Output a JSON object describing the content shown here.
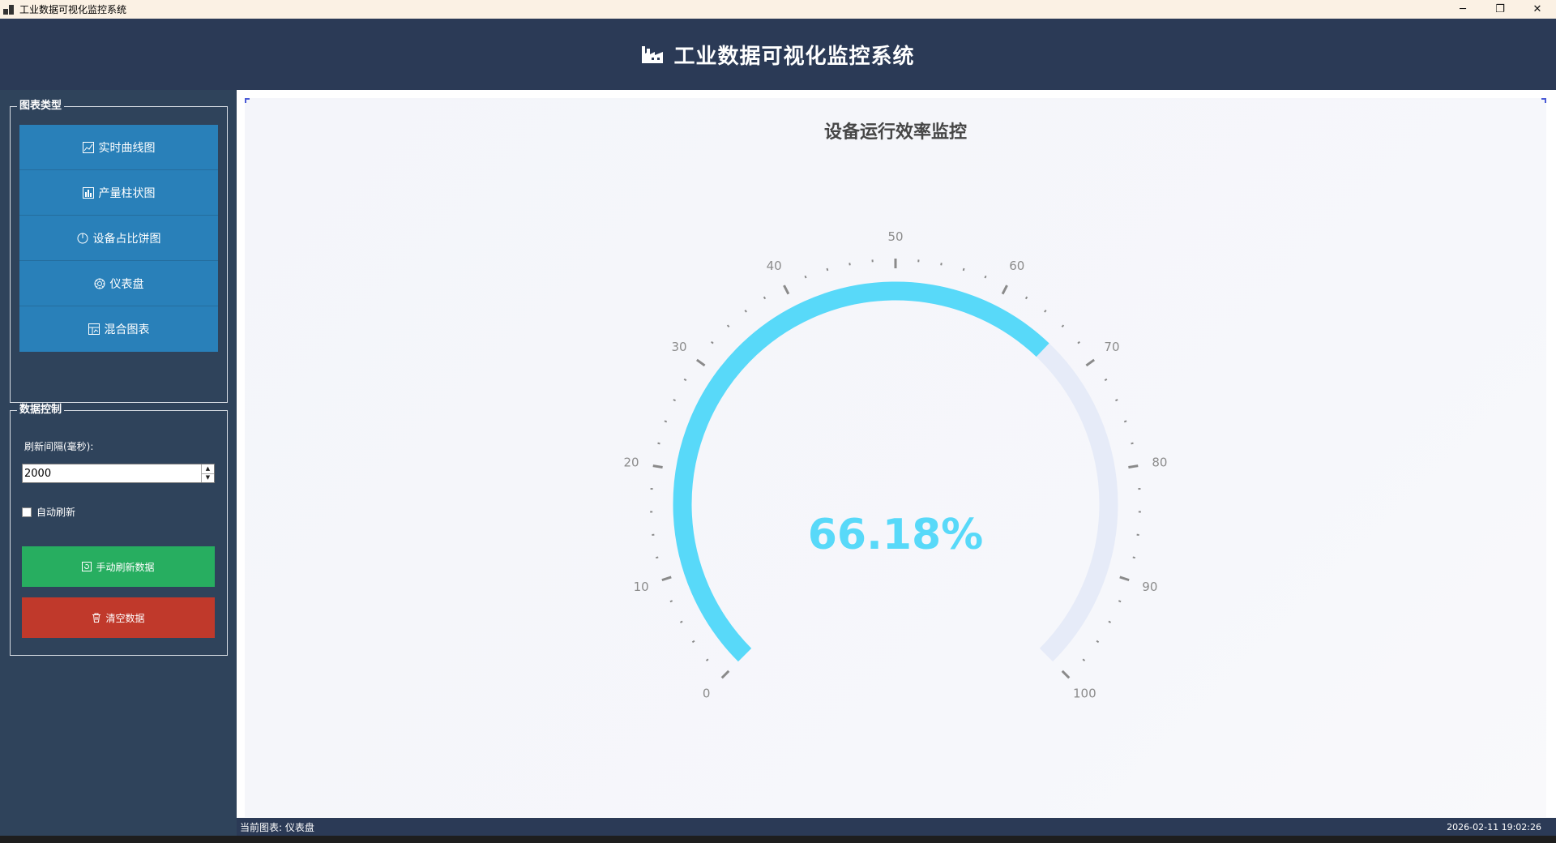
{
  "window": {
    "title": "工业数据可视化监控系统",
    "minimize": "─",
    "restore": "❐",
    "close": "✕"
  },
  "header": {
    "title": "工业数据可视化监控系统",
    "icon": "factory-icon"
  },
  "sidebar": {
    "chart_group_title": "图表类型",
    "chart_buttons": [
      {
        "label": "实时曲线图",
        "icon": "line-chart-icon"
      },
      {
        "label": "产量柱状图",
        "icon": "bar-chart-icon"
      },
      {
        "label": "设备占比饼图",
        "icon": "pie-chart-icon"
      },
      {
        "label": "仪表盘",
        "icon": "gauge-icon"
      },
      {
        "label": "混合图表",
        "icon": "mixed-chart-icon"
      }
    ],
    "data_group_title": "数据控制",
    "interval_label": "刷新间隔(毫秒):",
    "interval_value": "2000",
    "auto_refresh_label": "自动刷新",
    "auto_refresh_checked": false,
    "manual_refresh_label": "手动刷新数据",
    "clear_label": "清空数据",
    "colors": {
      "nav": "#2980b9",
      "refresh": "#27ae60",
      "clear": "#c0392b"
    }
  },
  "chart_data": {
    "type": "gauge",
    "title": "设备运行效率监控",
    "value": 66.18,
    "value_text": "66.18%",
    "min": 0,
    "max": 100,
    "tick_labels": [
      "0",
      "10",
      "20",
      "30",
      "40",
      "50",
      "60",
      "70",
      "80",
      "90",
      "100"
    ],
    "progress_color": "#58d9f9",
    "track_color": "#e6ebf8"
  },
  "status": {
    "current_chart": "当前图表: 仪表盘",
    "timestamp": "2026-02-11 19:02:26"
  }
}
